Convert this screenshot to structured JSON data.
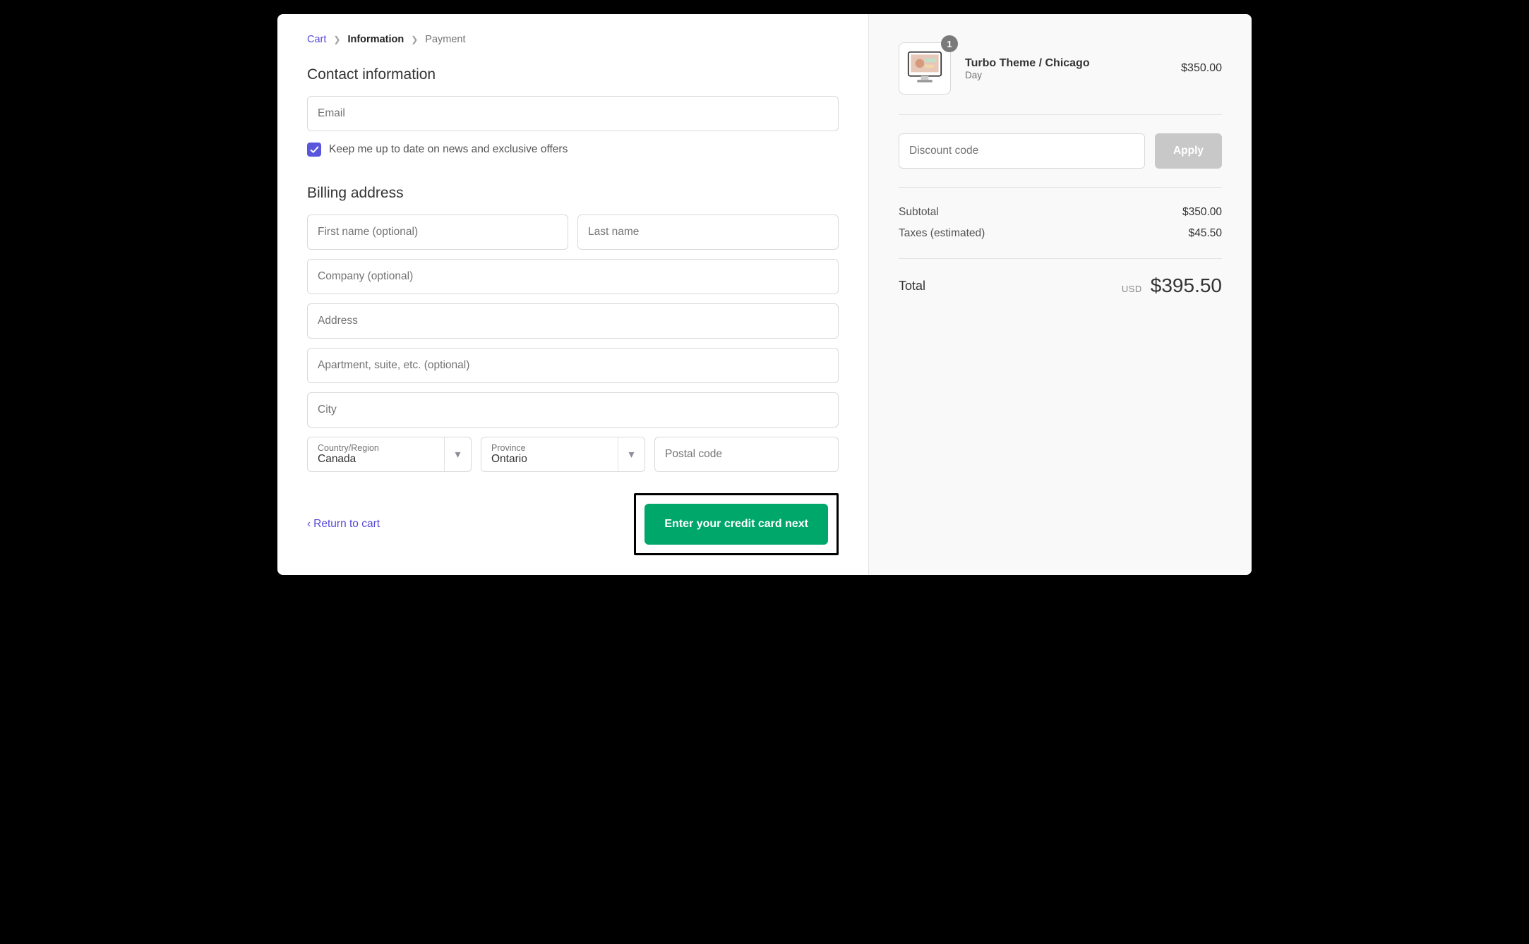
{
  "breadcrumbs": {
    "cart": "Cart",
    "information": "Information",
    "payment": "Payment"
  },
  "contact": {
    "heading": "Contact information",
    "email_placeholder": "Email",
    "newsletter_label": "Keep me up to date on news and exclusive offers"
  },
  "billing": {
    "heading": "Billing address",
    "first_name_placeholder": "First name (optional)",
    "last_name_placeholder": "Last name",
    "company_placeholder": "Company (optional)",
    "address_placeholder": "Address",
    "apartment_placeholder": "Apartment, suite, etc. (optional)",
    "city_placeholder": "City",
    "country_label": "Country/Region",
    "country_value": "Canada",
    "province_label": "Province",
    "province_value": "Ontario",
    "postal_placeholder": "Postal code"
  },
  "footer": {
    "return_label": "Return to cart",
    "cta_label": "Enter your credit card next"
  },
  "sidebar": {
    "product": {
      "name": "Turbo Theme / Chicago",
      "variant": "Day",
      "price": "$350.00",
      "qty": "1"
    },
    "discount_placeholder": "Discount code",
    "apply_label": "Apply",
    "subtotal_label": "Subtotal",
    "subtotal_value": "$350.00",
    "taxes_label": "Taxes (estimated)",
    "taxes_value": "$45.50",
    "total_label": "Total",
    "total_currency": "USD",
    "total_value": "$395.50"
  }
}
